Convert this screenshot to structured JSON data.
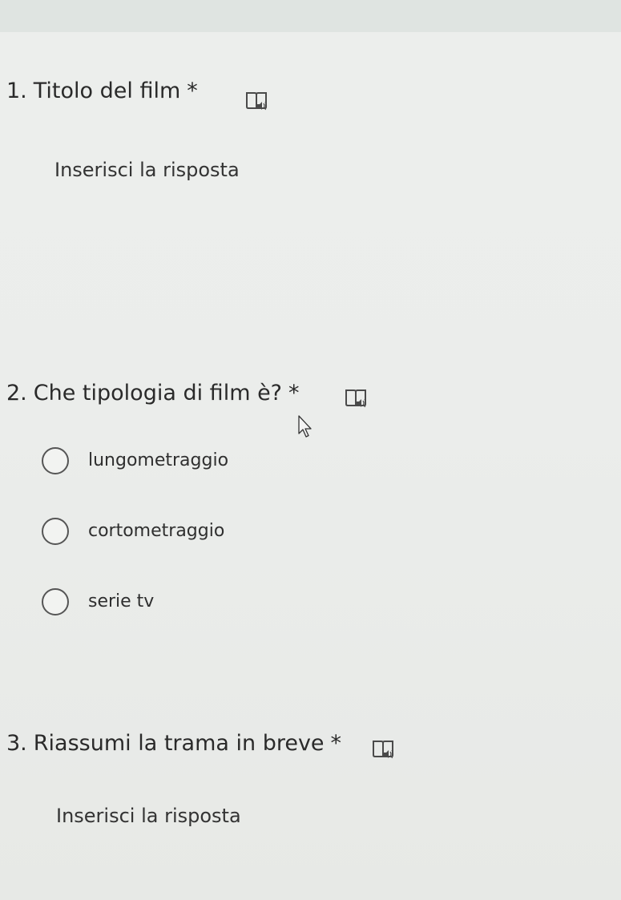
{
  "questions": [
    {
      "number": "1.",
      "title": "Titolo del film",
      "required_mark": "*",
      "type": "text",
      "answer_placeholder": "Inserisci la risposta",
      "reader_icon": "immersive-reader-icon"
    },
    {
      "number": "2.",
      "title": "Che tipologia di film è?",
      "required_mark": "*",
      "type": "choice",
      "reader_icon": "immersive-reader-icon",
      "options": [
        {
          "label": "lungometraggio",
          "selected": false
        },
        {
          "label": "cortometraggio",
          "selected": false
        },
        {
          "label": "serie tv",
          "selected": false
        }
      ]
    },
    {
      "number": "3.",
      "title": "Riassumi la trama in breve",
      "required_mark": "*",
      "type": "text",
      "answer_placeholder": "Inserisci la risposta",
      "reader_icon": "immersive-reader-icon"
    }
  ],
  "cursor_icon": "mouse-pointer-icon"
}
